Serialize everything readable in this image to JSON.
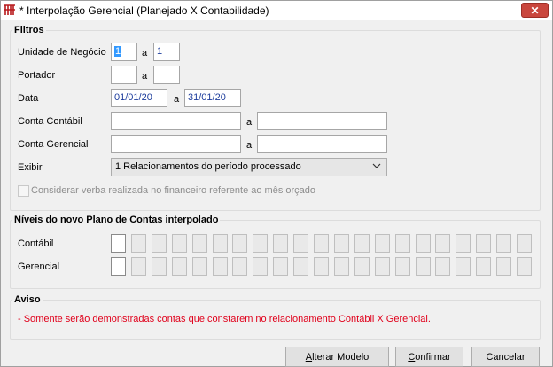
{
  "window": {
    "title": "* Interpolação Gerencial (Planejado X Contabilidade)"
  },
  "filtros": {
    "legend": "Filtros",
    "unidade": {
      "label": "Unidade de Negócio",
      "from": "1",
      "sep": "a",
      "to": "1"
    },
    "portador": {
      "label": "Portador",
      "from": "",
      "sep": "a",
      "to": ""
    },
    "data": {
      "label": "Data",
      "from": "01/01/20",
      "sep": "a",
      "to": "31/01/20"
    },
    "conta_contabil": {
      "label": "Conta Contábil",
      "from": "",
      "sep": "a",
      "to": ""
    },
    "conta_gerencial": {
      "label": "Conta Gerencial",
      "from": "",
      "sep": "a",
      "to": ""
    },
    "exibir": {
      "label": "Exibir",
      "value": "1 Relacionamentos do período processado"
    },
    "considerar": {
      "label": "Considerar verba realizada no financeiro referente ao mês orçado",
      "checked": false
    }
  },
  "niveis": {
    "legend": "Níveis do novo Plano de Contas interpolado",
    "contabil_label": "Contábil",
    "gerencial_label": "Gerencial"
  },
  "aviso": {
    "legend": "Aviso",
    "message": "- Somente serão demonstradas contas que constarem no relacionamento Contábil X Gerencial."
  },
  "buttons": {
    "alterar_first": "A",
    "alterar_rest": "lterar Modelo",
    "confirmar_first": "C",
    "confirmar_rest": "onfirmar",
    "cancelar_first": "",
    "cancelar_rest": "Cancelar"
  },
  "colors": {
    "warning": "#e0001b",
    "close": "#c9463d",
    "selection": "#3399ff"
  }
}
